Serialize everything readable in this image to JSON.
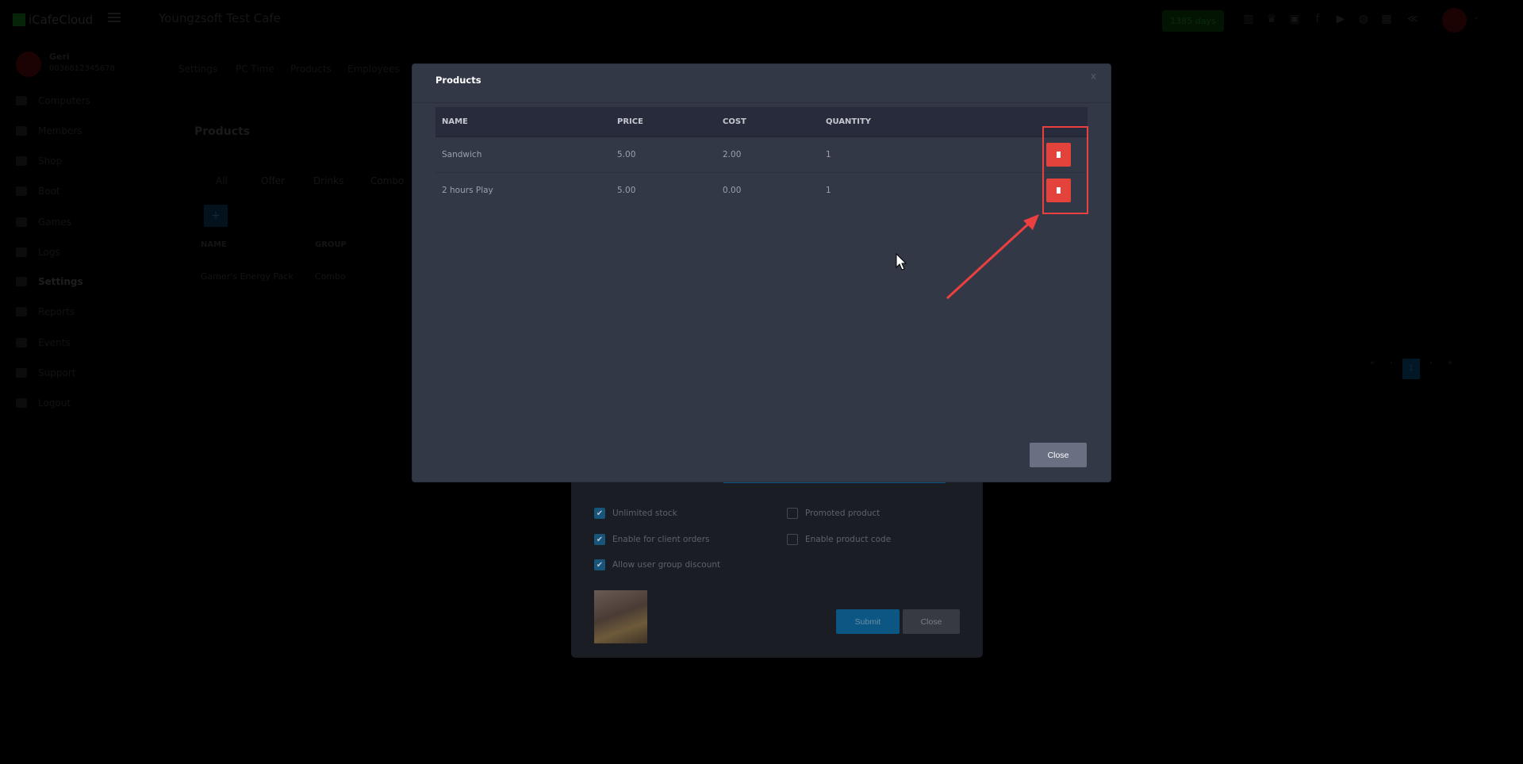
{
  "app": {
    "logo": "iCafeCloud",
    "cafe_name": "Youngzsoft Test Cafe",
    "days_badge": "1385 days"
  },
  "user": {
    "name": "Geri",
    "phone": "0036812345678"
  },
  "topbar_icons": [
    "ranking-icon",
    "trophy-icon",
    "discord-icon",
    "facebook-icon",
    "youtube-icon",
    "globe-icon",
    "calendar-icon",
    "brand-icon"
  ],
  "sidebar": {
    "items": [
      {
        "label": "Computers"
      },
      {
        "label": "Members"
      },
      {
        "label": "Shop"
      },
      {
        "label": "Boot"
      },
      {
        "label": "Games"
      },
      {
        "label": "Logs"
      },
      {
        "label": "Settings"
      },
      {
        "label": "Reports"
      },
      {
        "label": "Events"
      },
      {
        "label": "Support"
      },
      {
        "label": "Logout"
      }
    ]
  },
  "settings_tabs": [
    "Settings",
    "PC Time",
    "Products",
    "Employees"
  ],
  "bg_page": {
    "title": "Products",
    "categories": [
      "All",
      "Offer",
      "Drinks",
      "Combo"
    ],
    "add_label": "+",
    "columns": [
      "NAME",
      "GROUP"
    ],
    "rows": [
      {
        "name": "Gamer's Energy Pack",
        "group": "Combo"
      }
    ],
    "pagination": [
      "«",
      "‹",
      "1",
      "›",
      "»"
    ]
  },
  "modal": {
    "title": "Products",
    "close_x": "x",
    "columns": [
      "NAME",
      "PRICE",
      "COST",
      "QUANTITY"
    ],
    "rows": [
      {
        "name": "Sandwich",
        "price": "5.00",
        "cost": "2.00",
        "quantity": "1"
      },
      {
        "name": "2 hours Play",
        "price": "5.00",
        "cost": "0.00",
        "quantity": "1"
      }
    ],
    "close_label": "Close"
  },
  "edit_form": {
    "checkboxes": [
      {
        "label": "Unlimited stock",
        "checked": true
      },
      {
        "label": "Promoted product",
        "checked": false
      },
      {
        "label": "Enable for client orders",
        "checked": true
      },
      {
        "label": "Enable product code",
        "checked": false
      },
      {
        "label": "Allow user group discount",
        "checked": true
      }
    ],
    "submit_label": "Submit",
    "close_label": "Close"
  },
  "colors": {
    "danger": "#e4433b",
    "annotation": "#ec3f3f",
    "modal_bg": "#333847",
    "primary": "#18557a"
  }
}
